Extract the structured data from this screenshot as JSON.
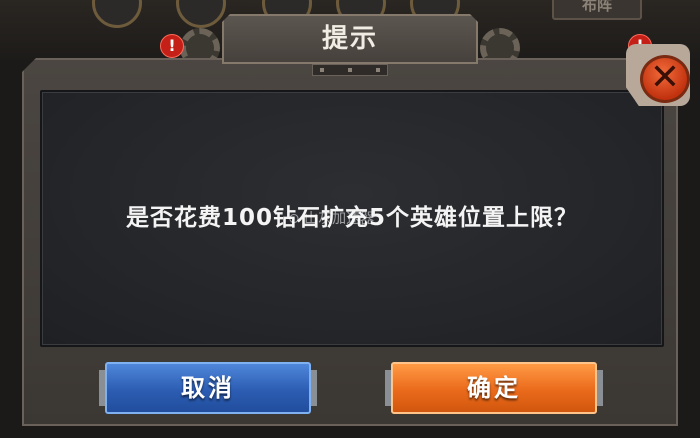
{
  "background": {
    "formation_tab_label": "布阵"
  },
  "dialog": {
    "title": "提示",
    "message": "是否花费100钻石扩充5个英雄位置上限？",
    "watermark": "⊙ 山灰加速器",
    "close_glyph": "✕",
    "alert_glyph": "!",
    "confirm_label": "确定",
    "cancel_label": "取消"
  },
  "colors": {
    "confirm_button": "#ea6a1b",
    "cancel_button": "#2c5db3",
    "close_button": "#d63f12"
  },
  "icons": [
    "close-icon",
    "gear-icon",
    "alert-icon"
  ]
}
